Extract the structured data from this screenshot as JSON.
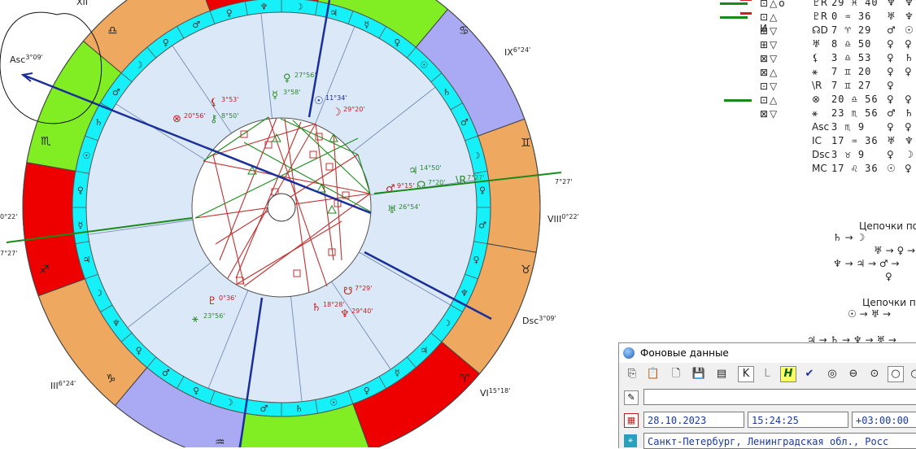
{
  "chart": {
    "house_labels": [
      {
        "id": "xii",
        "text": "XII",
        "deg": ""
      },
      {
        "id": "asc",
        "text": "Asc",
        "deg": "3°09'"
      },
      {
        "id": "ix",
        "text": "IX",
        "deg": "6°24'"
      },
      {
        "id": "viii",
        "text": "VIII",
        "deg": "0°22'"
      },
      {
        "id": "dsc",
        "text": "Dsc",
        "deg": "3°09'"
      },
      {
        "id": "vi",
        "text": "VI",
        "deg": "15°18'"
      },
      {
        "id": "iii",
        "text": "III",
        "deg": "6°24'"
      },
      {
        "id": "cusp-7-27",
        "text": "",
        "deg": "7°27'"
      },
      {
        "id": "left-0-22",
        "text": "",
        "deg": "0°22'"
      },
      {
        "id": "left-7-27",
        "text": "",
        "deg": "7°27'"
      }
    ],
    "planets": [
      {
        "id": "pluto-top",
        "glyph": "♀",
        "deg": "27°56'",
        "color": "#2a8a2a"
      },
      {
        "id": "neptune-top",
        "glyph": "☿",
        "deg": "3°58'",
        "color": "#2a8a2a"
      },
      {
        "id": "sun",
        "glyph": "☉",
        "deg": "11°34'",
        "color": "#1a2a9a"
      },
      {
        "id": "moon",
        "glyph": "☽",
        "deg": "29°20'",
        "color": "#c02020"
      },
      {
        "id": "lilith",
        "glyph": "⚸",
        "deg": "3°53'",
        "color": "#c02020"
      },
      {
        "id": "chiron",
        "glyph": "⚷",
        "deg": "8°50'",
        "color": "#2a8a2a"
      },
      {
        "id": "fortune",
        "glyph": "⊗",
        "deg": "20°56'",
        "color": "#c02020"
      },
      {
        "id": "jupiter",
        "glyph": "♃",
        "deg": "14°50'",
        "color": "#2a8a2a"
      },
      {
        "id": "mars",
        "glyph": "♂",
        "deg": "9°15'",
        "color": "#c02020"
      },
      {
        "id": "node",
        "glyph": "☊",
        "deg": "7°20'",
        "color": "#2a8a2a"
      },
      {
        "id": "r-node",
        "glyph": "\\R",
        "deg": "7°27'",
        "color": "#2a8a2a"
      },
      {
        "id": "uranus",
        "glyph": "♅",
        "deg": "26°54'",
        "color": "#2a8a2a"
      },
      {
        "id": "south-node",
        "glyph": "☋",
        "deg": "7°29'",
        "color": "#c02020"
      },
      {
        "id": "pluto-r",
        "glyph": "♇",
        "deg": "0°36'",
        "color": "#c02020"
      },
      {
        "id": "saturn-r",
        "glyph": "♄",
        "deg": "18°28'",
        "color": "#c02020"
      },
      {
        "id": "neptune-r",
        "glyph": "♆",
        "deg": "29°40'",
        "color": "#c02020"
      },
      {
        "id": "ceres",
        "glyph": "⚹",
        "deg": "23°56'",
        "color": "#2a8a2a"
      }
    ]
  },
  "aspects": [
    {
      "mark": "green-red",
      "sym": "⊡△ᴏ",
      "planet": "♇R",
      "deg": "29 ♓ 40",
      "r1": "♆",
      "r2": "♆"
    },
    {
      "mark": "green-red",
      "sym": "⊡△ И",
      "planet": "♇R",
      "deg": "0 ♒ 36",
      "r1": "♅",
      "r2": "♆"
    },
    {
      "mark": "",
      "sym": "⊞▽",
      "planet": "☊D",
      "deg": "7 ♈ 29",
      "r1": "♂",
      "r2": "☉"
    },
    {
      "mark": "",
      "sym": "⊞▽",
      "planet": "♅",
      "deg": "8 ♎ 50",
      "r1": "♀",
      "r2": "♀"
    },
    {
      "mark": "",
      "sym": "⊠▽",
      "planet": "⚸",
      "deg": "3 ♎ 53",
      "r1": "♀",
      "r2": "♄"
    },
    {
      "mark": "",
      "sym": "⊠△",
      "planet": "⚹",
      "deg": "7 ♊ 20",
      "r1": "♀",
      "r2": "♀"
    },
    {
      "mark": "",
      "sym": "⊡▽",
      "planet": "\\R",
      "deg": "7 ♊ 27",
      "r1": "♀",
      "r2": ""
    },
    {
      "mark": "green",
      "sym": "⊡△",
      "planet": "⊗",
      "deg": "20 ♎ 56",
      "r1": "♀",
      "r2": "♀"
    },
    {
      "mark": "",
      "sym": "⊠▽",
      "planet": "⚹",
      "deg": "23 ♏ 56",
      "r1": "♂",
      "r2": "♄"
    },
    {
      "mark": "",
      "sym": "",
      "planet": "Asc",
      "deg": "3 ♏ 9",
      "r1": "♀",
      "r2": "♀"
    },
    {
      "mark": "",
      "sym": "",
      "planet": "IC",
      "deg": "17 ♒ 36",
      "r1": "♅",
      "r2": "♆"
    },
    {
      "mark": "",
      "sym": "",
      "planet": "Dsc",
      "deg": "3 ♉ 9",
      "r1": "♀",
      "r2": "☽"
    },
    {
      "mark": "",
      "sym": "",
      "planet": "MC",
      "deg": "17 ♌ 36",
      "r1": "☉",
      "r2": "♀"
    }
  ],
  "chains": {
    "title1": "Цепочки по",
    "title2": "Цепочки по",
    "lines": [
      "♄ → ☽",
      "♅ → ♀ →",
      "♆ → ♃ → ♂ →",
      "♀",
      "☉ → ♅ →",
      "♃ → ♄ → ♆ → ♅ →"
    ]
  },
  "dialog": {
    "title": "Фоновые данные",
    "date": "28.10.2023",
    "time": "15:24:25",
    "tz": "+03:00:00",
    "place": "Санкт-Петербург, Ленинградская обл., Росс",
    "toolbar": [
      "copy-icon",
      "paste-icon",
      "new-icon",
      "save-icon",
      "table-icon",
      "K",
      "L",
      "H",
      "check-icon",
      "circle-s1",
      "circle-s2",
      "circle-s3",
      "circle-s4",
      "circle-s5"
    ]
  },
  "colors": {
    "ring_blue": "#aaaaf4",
    "ring_green": "#80ee22",
    "ring_red": "#ee0000",
    "ring_orange": "#efa860",
    "cyan": "#16f0f8",
    "inner": "#dbe8f7",
    "line_red": "#c03030",
    "line_green": "#1a8a1a",
    "axis_blue": "#1a2f9a"
  }
}
